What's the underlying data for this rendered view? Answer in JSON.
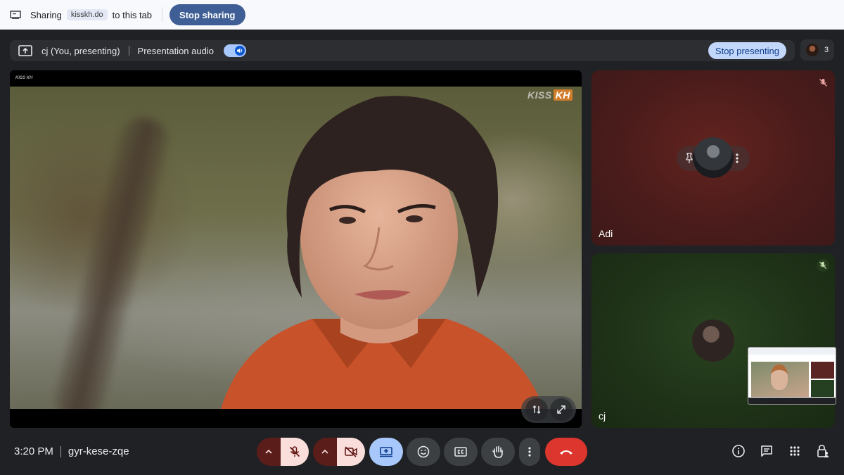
{
  "share_bar": {
    "sharing_label": "Sharing",
    "domain": "kisskh.do",
    "suffix": "to this tab",
    "stop_button": "Stop sharing"
  },
  "present_bar": {
    "presenter": "cj (You, presenting)",
    "audio_label": "Presentation audio",
    "audio_enabled": true,
    "stop_button": "Stop presenting"
  },
  "participants": {
    "count": "3"
  },
  "stage": {
    "site_logo": "KISS KH",
    "watermark_main": "KISS",
    "watermark_accent": "KH"
  },
  "tiles": [
    {
      "name": "Adi",
      "muted": true,
      "bg": "#4a1c1b"
    },
    {
      "name": "cj",
      "muted": true,
      "bg": "#1f3318"
    }
  ],
  "meeting": {
    "time": "3:20 PM",
    "code": "gyr-kese-zqe"
  },
  "colors": {
    "accent": "#a8c7fa",
    "leave": "#dc362e",
    "muted_control": "#f9dedc",
    "share_button": "#3f5e95"
  }
}
